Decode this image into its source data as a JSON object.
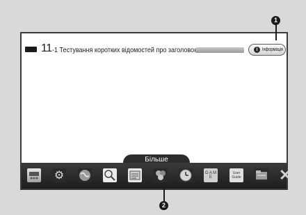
{
  "banner": {
    "channel_number": "11",
    "program_title": "-1 Тестування коротких відомостей про заголовок...",
    "progress": 0.0,
    "info_button": {
      "icon": "i",
      "label": "Інформація"
    }
  },
  "toolbar": {
    "more_label": "Більше",
    "icons": [
      {
        "name": "tv-channel-icon"
      },
      {
        "name": "settings-gear-icon"
      },
      {
        "name": "internet-globe-icon"
      },
      {
        "name": "search-icon"
      },
      {
        "name": "tv-schedule-icon"
      },
      {
        "name": "photo-apps-icon"
      },
      {
        "name": "clock-icon"
      },
      {
        "name": "game-icon",
        "text": "G A M E"
      },
      {
        "name": "user-guide-icon",
        "text": "User Guide"
      },
      {
        "name": "media-folder-icon"
      }
    ],
    "close_icon": "close-icon"
  },
  "callouts": [
    "1",
    "2"
  ]
}
